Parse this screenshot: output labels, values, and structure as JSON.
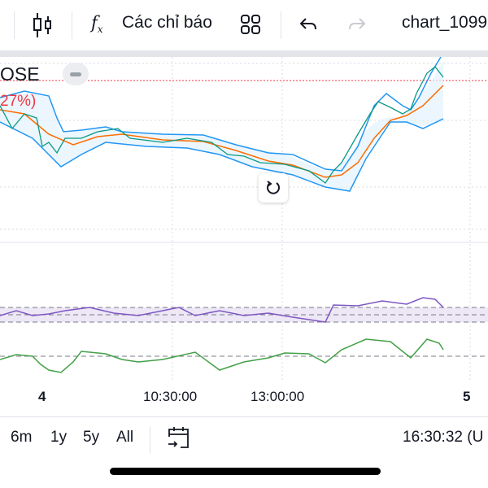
{
  "toolbar": {
    "indicators_label": "Các chỉ báo",
    "chart_name": "chart_1099"
  },
  "legend": {
    "symbol": "OSE",
    "change": "27%)"
  },
  "time_axis": [
    "4",
    "10:30:00",
    "13:00:00",
    "5"
  ],
  "bottom": {
    "ranges": [
      "6m",
      "1y",
      "5y",
      "All"
    ],
    "clock": "16:30:32 (U"
  },
  "colors": {
    "up": "#089981",
    "down": "#f23645",
    "bb": "#2196f3",
    "ma": "#ff6d00",
    "rsi": "#7e57c2",
    "osc": "#43a047"
  }
}
